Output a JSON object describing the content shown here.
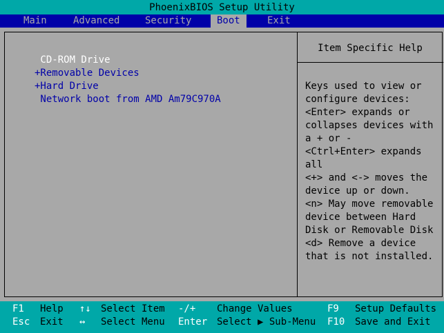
{
  "title": "PhoenixBIOS Setup Utility",
  "menu": [
    {
      "label": "Main",
      "active": false
    },
    {
      "label": "Advanced",
      "active": false
    },
    {
      "label": "Security",
      "active": false
    },
    {
      "label": "Boot",
      "active": true
    },
    {
      "label": "Exit",
      "active": false
    }
  ],
  "boot_items": [
    {
      "label": " CD-ROM Drive",
      "selected": true
    },
    {
      "label": "+Removable Devices",
      "selected": false
    },
    {
      "label": "+Hard Drive",
      "selected": false
    },
    {
      "label": " Network boot from AMD Am79C970A",
      "selected": false
    }
  ],
  "help": {
    "title": "Item Specific Help",
    "lines": [
      "Keys used to view or",
      "configure devices:",
      "<Enter> expands or",
      "collapses devices with",
      "a + or -",
      "<Ctrl+Enter> expands",
      "all",
      "<+> and <-> moves the",
      "device up or down.",
      "<n> May move removable",
      "device between Hard",
      "Disk or Removable Disk",
      "<d> Remove a device",
      "that is not installed."
    ]
  },
  "status": {
    "row1": {
      "k1": "F1",
      "d1": "Help",
      "k2": "↑↓",
      "d2": "Select Item",
      "k3": "-/+",
      "d3": "Change Values",
      "k4": "F9",
      "d4": "Setup Defaults"
    },
    "row2": {
      "k1": "Esc",
      "d1": "Exit",
      "k2": "↔",
      "d2": "Select Menu",
      "k3": "Enter",
      "d3": "Select ▶ Sub-Menu",
      "k4": "F10",
      "d4": "Save and Exit"
    }
  },
  "colors": {
    "bios_blue": "#0000a8",
    "bios_gray": "#a8a8a8",
    "bios_cyan": "#00a8a8",
    "highlight_white": "#ffffff"
  }
}
